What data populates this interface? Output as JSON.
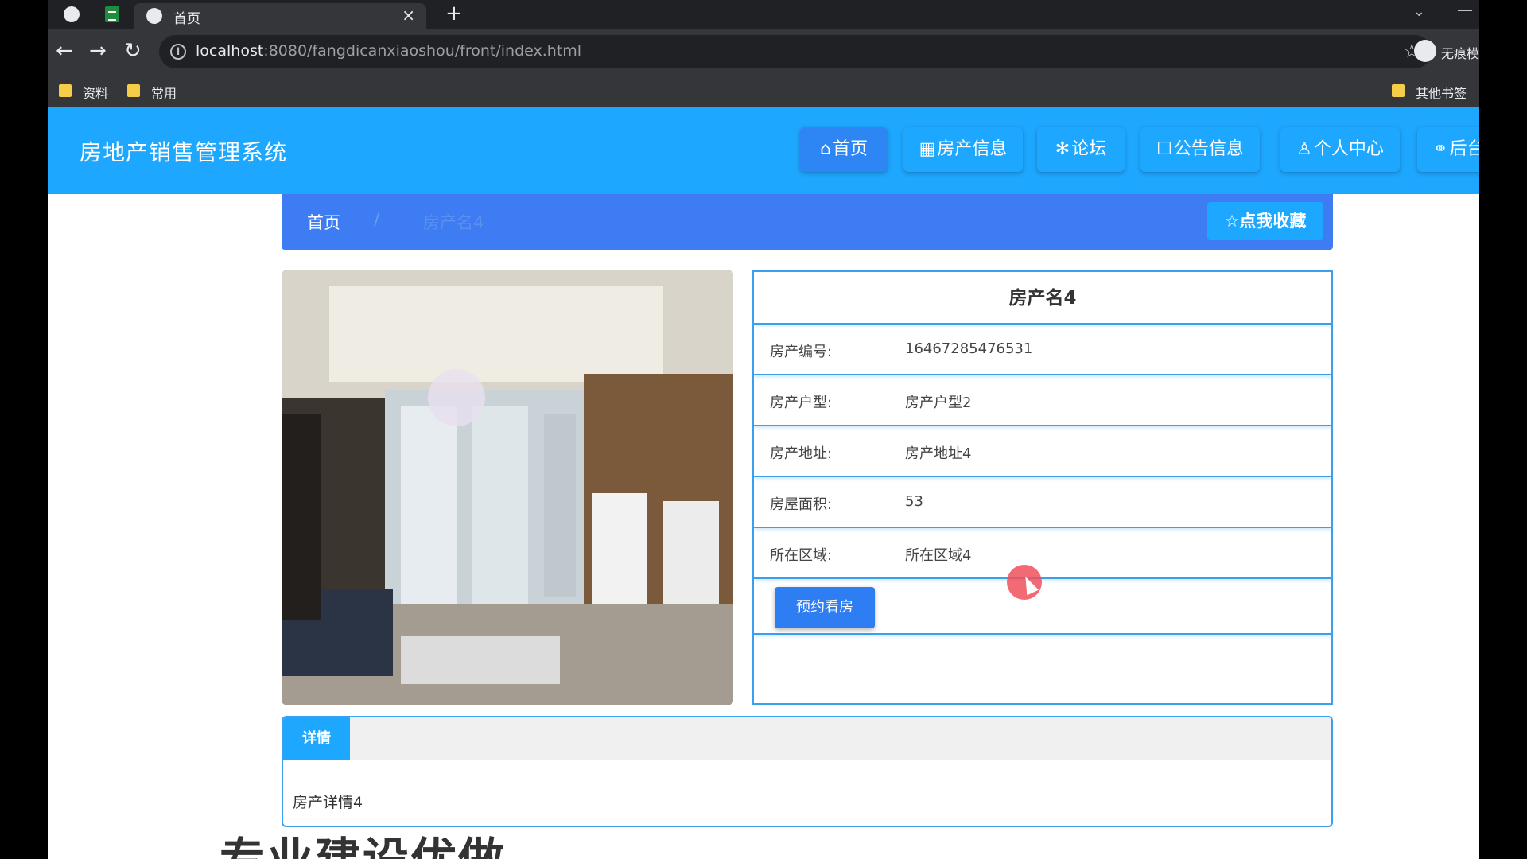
{
  "browser": {
    "active_tab_title": "首页",
    "tab_close": "×",
    "new_tab": "+",
    "url_host": "localhost",
    "url_path": ":8080/fangdicanxiaoshou/front/index.html",
    "profile_label": "无痕模",
    "bookmarks": [
      "资料",
      "常用"
    ],
    "other_bookmarks": "其他书签"
  },
  "site": {
    "title": "房地产销售管理系统",
    "nav": [
      {
        "icon": "⌂",
        "label": "首页"
      },
      {
        "icon": "▦",
        "label": "房产信息"
      },
      {
        "icon": "✻",
        "label": "论坛"
      },
      {
        "icon": "☐",
        "label": "公告信息"
      },
      {
        "icon": "♙",
        "label": "个人中心"
      },
      {
        "icon": "⚭",
        "label": "后台"
      }
    ]
  },
  "breadcrumb": {
    "home": "首页",
    "separator": "/",
    "current": "房产名4",
    "favorite_button": "☆点我收藏"
  },
  "property": {
    "name": "房产名4",
    "fields": [
      {
        "label": "房产编号:",
        "value": "16467285476531"
      },
      {
        "label": "房产户型:",
        "value": "房产户型2"
      },
      {
        "label": "房产地址:",
        "value": "房产地址4"
      },
      {
        "label": "房屋面积:",
        "value": "53"
      },
      {
        "label": "所在区域:",
        "value": "所在区域4"
      }
    ],
    "book_button": "预约看房"
  },
  "detail": {
    "tab_label": "详情",
    "content": "房产详情4"
  },
  "footer_big_text": "专业建设优做"
}
